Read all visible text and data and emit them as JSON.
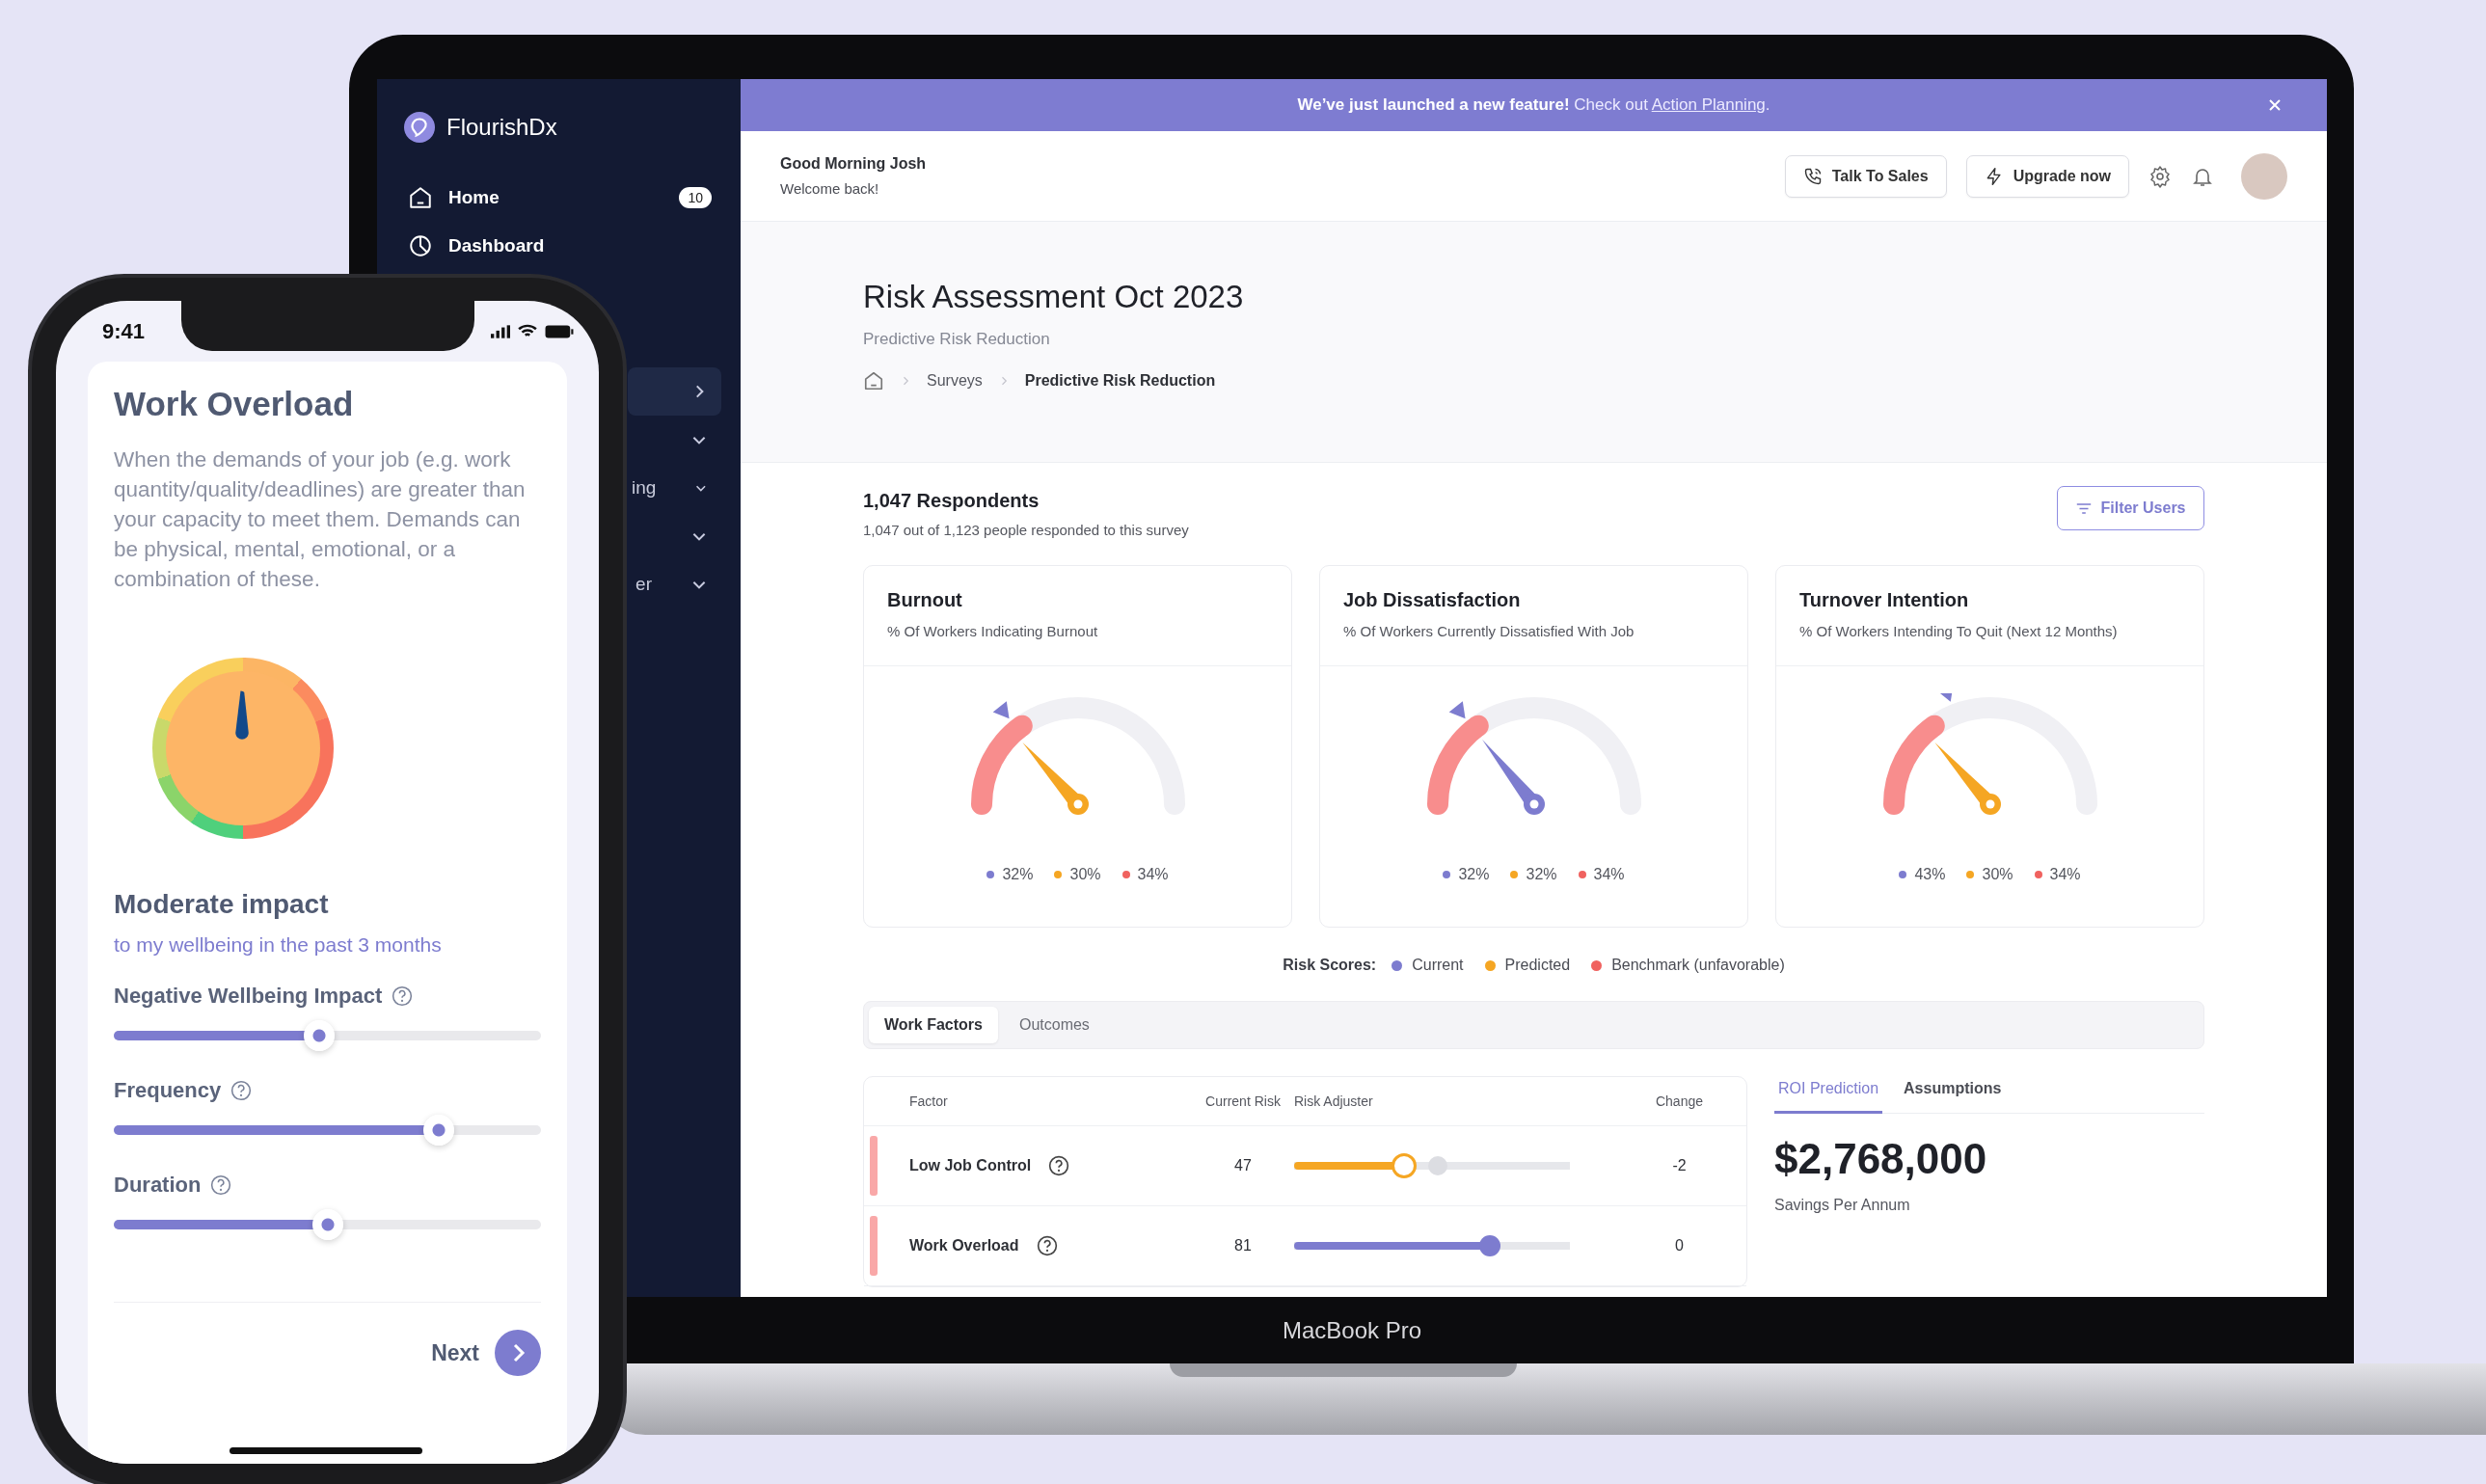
{
  "laptop": {
    "sidebar": {
      "brand": "FlourishDx",
      "items": [
        {
          "kind": "page",
          "label": "Home",
          "badge": "10",
          "selected": false
        },
        {
          "kind": "page",
          "label": "Dashboard",
          "selected": false
        },
        {
          "kind": "submenu",
          "selected": true
        },
        {
          "kind": "group",
          "selected": false
        },
        {
          "kind": "group",
          "label": "ing",
          "selected": false
        },
        {
          "kind": "group",
          "selected": false
        },
        {
          "kind": "group",
          "label": "er",
          "selected": false
        }
      ]
    },
    "banner": {
      "text": "**We’ve just launched a new feature!** Check out ",
      "link": "Action Planning",
      "after": "."
    },
    "header": {
      "greeting": "Good Morning Josh",
      "welcome": "Welcome back!",
      "buttons": [
        "Talk To Sales",
        "Upgrade now"
      ]
    },
    "page": {
      "title": "Risk Assessment Oct 2023",
      "subtitle": "Predictive Risk Reduction",
      "breadcrumb": [
        {
          "label": "Surveys",
          "current": false
        },
        {
          "label": "Predictive Risk Reduction",
          "current": true
        }
      ]
    },
    "respondents": {
      "title": "1,047 Respondents",
      "subtitle": "1,047 out of 1,123 people responded to this survey",
      "filter": "Filter Users"
    },
    "cards": [
      {
        "title": "Burnout",
        "subtitle": "% Of Workers Indicating Burnout",
        "values": [
          {
            "text": "32%",
            "color": "#7d7ccf"
          },
          {
            "text": "30%",
            "color": "#f5a623"
          },
          {
            "text": "34%",
            "color": "#f0625f"
          }
        ]
      },
      {
        "title": "Job Dissatisfaction",
        "subtitle": "% Of Workers Currently Dissatisfied With Job",
        "values": [
          {
            "text": "32%",
            "color": "#7d7ccf"
          },
          {
            "text": "32%",
            "color": "#f5a623"
          },
          {
            "text": "34%",
            "color": "#f0625f"
          }
        ]
      },
      {
        "title": "Turnover Intention",
        "subtitle": "% Of Workers Intending To Quit (Next 12 Months)",
        "values": [
          {
            "text": "43%",
            "color": "#7d7ccf"
          },
          {
            "text": "30%",
            "color": "#f5a623"
          },
          {
            "text": "34%",
            "color": "#f0625f"
          }
        ]
      }
    ],
    "legend": {
      "label": "Risk Scores:",
      "items": [
        {
          "label": "Current",
          "color": "#7d7ccf"
        },
        {
          "label": "Predicted",
          "color": "#f5a623"
        },
        {
          "label": "Benchmark (unfavorable)",
          "color": "#f0625f"
        }
      ]
    },
    "tabs": [
      {
        "label": "Work Factors",
        "selected": true
      },
      {
        "label": "Outcomes",
        "selected": false
      }
    ],
    "table": {
      "columns": [
        "Factor",
        "Current Risk",
        "Risk Adjuster",
        "Change"
      ],
      "rows": [
        {
          "factor": "Low Job Control",
          "current_risk": "47",
          "adjusted": true,
          "level": 0.4,
          "baseline": {
            "level": 0.52
          },
          "change": "-2"
        },
        {
          "factor": "Work Overload",
          "current_risk": "81",
          "adjusted": false,
          "level": 0.71,
          "change": "0"
        }
      ]
    },
    "roi": {
      "tabs": [
        {
          "label": "ROI Prediction",
          "selected": true
        },
        {
          "label": "Assumptions",
          "selected": false
        }
      ],
      "value": "$2,768,000",
      "caption": "Savings Per Annum"
    },
    "device_label": "MacBook Pro"
  },
  "phone": {
    "time": "9:41",
    "title": "Work Overload",
    "description": "When the demands of your job (e.g. work quantity/quality/deadlines) are greater than your capacity to meet them. Demands can be physical, mental, emotional, or a combination of these.",
    "impact": "Moderate impact",
    "impact_note": "to my wellbeing in the past 3 months",
    "sliders": [
      {
        "label": "Negative Wellbeing Impact",
        "level": 0.48
      },
      {
        "label": "Frequency",
        "level": 0.76
      },
      {
        "label": "Duration",
        "level": 0.5
      }
    ],
    "next": "Next"
  }
}
